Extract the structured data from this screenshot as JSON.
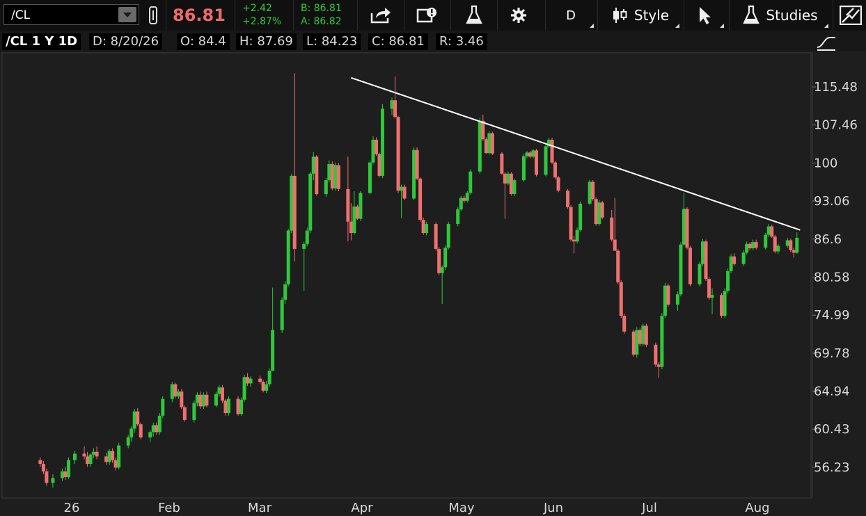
{
  "toolbar": {
    "symbol": "/CL",
    "last_price": "86.81",
    "change": "+2.42",
    "change_pct": "+2.87%",
    "bid": "B: 86.81",
    "ask": "A: 86.82",
    "aggregation": "D",
    "style_label": "Style",
    "studies_label": "Studies",
    "icons": [
      "link-icon",
      "share-icon",
      "screenshot-icon",
      "flask-icon",
      "gear-icon",
      "style-icon",
      "cursor-icon",
      "studies-flask-icon",
      "drawing-icon"
    ]
  },
  "info": {
    "symbol_period": "/CL 1 Y 1D",
    "date": "D: 8/20/26",
    "open": "O: 84.4",
    "high": "H: 87.69",
    "low": "L: 84.23",
    "close": "C: 86.81",
    "range": "R: 3.46"
  },
  "colors": {
    "up": "#2ec93a",
    "down": "#f07070",
    "background": "#1e1e1e",
    "trendline": "#ffffff"
  },
  "chart_data": {
    "type": "candlestick",
    "symbol": "/CL",
    "y_ticks": [
      "115.48",
      "107.46",
      "100",
      "93.06",
      "86.6",
      "80.58",
      "74.99",
      "69.78",
      "64.94",
      "60.43",
      "56.23"
    ],
    "y_scale": "log",
    "x_ticks": [
      "26",
      "Feb",
      "Mar",
      "Apr",
      "May",
      "Jun",
      "Jul",
      "Aug"
    ],
    "trendline": [
      {
        "date": "2026-03-31",
        "price": 117.5
      },
      {
        "date": "2026-08-21",
        "price": 88.1
      }
    ],
    "candles": [
      [
        "2025-12-22",
        57.0,
        57.3,
        56.3,
        56.6
      ],
      [
        "2025-12-23",
        56.6,
        56.9,
        55.5,
        55.8
      ],
      [
        "2025-12-24",
        55.8,
        56.1,
        54.3,
        54.6
      ],
      [
        "2025-12-26",
        54.6,
        55.5,
        54.1,
        55.1
      ],
      [
        "2025-12-29",
        55.1,
        56.1,
        54.8,
        55.8
      ],
      [
        "2025-12-30",
        55.8,
        56.3,
        54.9,
        55.2
      ],
      [
        "2025-12-31",
        55.2,
        57.3,
        55.0,
        57.0
      ],
      [
        "2026-01-02",
        57.0,
        58.0,
        56.6,
        57.7
      ],
      [
        "2026-01-05",
        57.7,
        58.5,
        57.1,
        57.4
      ],
      [
        "2026-01-06",
        57.4,
        57.9,
        56.3,
        56.6
      ],
      [
        "2026-01-07",
        56.6,
        57.8,
        56.3,
        57.6
      ],
      [
        "2026-01-08",
        57.6,
        58.3,
        57.2,
        57.9
      ],
      [
        "2026-01-09",
        57.9,
        58.5,
        57.1,
        57.4
      ],
      [
        "2026-01-12",
        57.4,
        57.8,
        56.5,
        56.8
      ],
      [
        "2026-01-13",
        56.8,
        58.2,
        56.5,
        58.0
      ],
      [
        "2026-01-14",
        58.0,
        58.3,
        56.7,
        57.0
      ],
      [
        "2026-01-15",
        57.0,
        57.3,
        55.9,
        56.2
      ],
      [
        "2026-01-16",
        56.2,
        58.9,
        56.0,
        58.6
      ],
      [
        "2026-01-19",
        58.6,
        59.8,
        58.3,
        59.5
      ],
      [
        "2026-01-20",
        59.5,
        60.8,
        59.0,
        60.5
      ],
      [
        "2026-01-21",
        60.5,
        62.8,
        60.0,
        62.5
      ],
      [
        "2026-01-22",
        62.5,
        62.9,
        60.8,
        61.0
      ],
      [
        "2026-01-23",
        61.0,
        61.2,
        59.3,
        59.5
      ],
      [
        "2026-01-26",
        59.5,
        60.3,
        59.0,
        60.1
      ],
      [
        "2026-01-27",
        60.1,
        61.2,
        59.6,
        60.9
      ],
      [
        "2026-01-28",
        60.9,
        61.2,
        59.8,
        60.1
      ],
      [
        "2026-01-29",
        60.1,
        62.3,
        59.8,
        62.0
      ],
      [
        "2026-01-30",
        62.0,
        64.3,
        61.7,
        64.0
      ],
      [
        "2026-02-02",
        64.0,
        66.1,
        63.6,
        65.8
      ],
      [
        "2026-02-03",
        65.8,
        66.0,
        64.1,
        64.3
      ],
      [
        "2026-02-04",
        64.3,
        65.2,
        64.0,
        64.9
      ],
      [
        "2026-02-05",
        64.9,
        65.2,
        62.8,
        63.0
      ],
      [
        "2026-02-06",
        63.0,
        63.2,
        61.3,
        61.5
      ],
      [
        "2026-02-09",
        61.5,
        63.8,
        61.2,
        63.5
      ],
      [
        "2026-02-10",
        63.5,
        64.8,
        63.1,
        64.5
      ],
      [
        "2026-02-11",
        64.5,
        64.9,
        62.8,
        63.1
      ],
      [
        "2026-02-12",
        63.1,
        64.8,
        62.8,
        64.5
      ],
      [
        "2026-02-13",
        64.5,
        64.9,
        63.0,
        63.2
      ],
      [
        "2026-02-16",
        63.2,
        64.9,
        63.0,
        64.6
      ],
      [
        "2026-02-17",
        64.6,
        65.7,
        64.3,
        65.4
      ],
      [
        "2026-02-18",
        65.4,
        65.7,
        63.5,
        63.8
      ],
      [
        "2026-02-19",
        63.8,
        64.0,
        62.0,
        62.3
      ],
      [
        "2026-02-20",
        62.3,
        64.3,
        62.0,
        64.0
      ],
      [
        "2026-02-23",
        64.0,
        64.3,
        62.0,
        62.2
      ],
      [
        "2026-02-24",
        62.2,
        64.2,
        62.0,
        63.9
      ],
      [
        "2026-02-25",
        63.9,
        67.0,
        63.6,
        66.7
      ],
      [
        "2026-02-26",
        66.7,
        67.2,
        65.6,
        65.9
      ],
      [
        "2026-02-27",
        65.9,
        66.8,
        65.5,
        66.5
      ],
      [
        "2026-03-02",
        66.5,
        66.9,
        65.8,
        66.1
      ],
      [
        "2026-03-03",
        66.1,
        66.3,
        64.8,
        65.0
      ],
      [
        "2026-03-04",
        65.0,
        66.2,
        64.7,
        65.8
      ],
      [
        "2026-03-05",
        65.8,
        67.8,
        65.5,
        67.5
      ],
      [
        "2026-03-06",
        67.5,
        79.0,
        70.5,
        72.9
      ],
      [
        "2026-03-09",
        72.9,
        77.6,
        72.5,
        77.2
      ],
      [
        "2026-03-10",
        77.2,
        80.0,
        76.6,
        79.5
      ],
      [
        "2026-03-11",
        79.5,
        88.3,
        79.2,
        88.0
      ],
      [
        "2026-03-12",
        88.0,
        98.0,
        87.6,
        97.6
      ],
      [
        "2026-03-13",
        97.6,
        118.5,
        83.0,
        85.0
      ],
      [
        "2026-03-16",
        85.0,
        86.2,
        78.5,
        85.8
      ],
      [
        "2026-03-17",
        85.8,
        88.5,
        85.4,
        88.0
      ],
      [
        "2026-03-18",
        88.0,
        98.4,
        87.6,
        98.0
      ],
      [
        "2026-03-19",
        98.0,
        102.1,
        96.8,
        101.2
      ],
      [
        "2026-03-20",
        101.2,
        101.5,
        94.0,
        94.3
      ],
      [
        "2026-03-23",
        94.3,
        97.2,
        93.8,
        96.8
      ],
      [
        "2026-03-24",
        96.8,
        100.5,
        96.4,
        99.8
      ],
      [
        "2026-03-25",
        99.8,
        100.3,
        95.0,
        95.3
      ],
      [
        "2026-03-26",
        95.3,
        100.1,
        94.9,
        99.6
      ],
      [
        "2026-03-27",
        99.6,
        100.0,
        94.8,
        95.2
      ],
      [
        "2026-03-30",
        95.2,
        101.2,
        86.2,
        89.5
      ],
      [
        "2026-03-31",
        89.5,
        92.7,
        86.4,
        87.6
      ],
      [
        "2026-04-01",
        87.6,
        94.8,
        87.3,
        92.1
      ],
      [
        "2026-04-02",
        92.1,
        92.4,
        89.8,
        90.0
      ],
      [
        "2026-04-03",
        90.0,
        94.8,
        89.6,
        94.5
      ],
      [
        "2026-04-06",
        94.5,
        100.5,
        94.2,
        100.1
      ],
      [
        "2026-04-07",
        100.1,
        105.2,
        99.7,
        104.5
      ],
      [
        "2026-04-08",
        104.5,
        105.0,
        101.4,
        101.7
      ],
      [
        "2026-04-09",
        101.7,
        102.0,
        97.3,
        97.6
      ],
      [
        "2026-04-10",
        97.6,
        111.8,
        97.2,
        110.8
      ],
      [
        "2026-04-13",
        110.8,
        113.2,
        109.5,
        112.6
      ],
      [
        "2026-04-14",
        112.6,
        117.8,
        108.8,
        109.1
      ],
      [
        "2026-04-15",
        109.1,
        109.3,
        94.5,
        94.9
      ],
      [
        "2026-04-16",
        94.9,
        96.0,
        90.1,
        95.6
      ],
      [
        "2026-04-17",
        95.6,
        96.0,
        93.2,
        93.5
      ],
      [
        "2026-04-20",
        93.5,
        103.0,
        93.2,
        102.5
      ],
      [
        "2026-04-21",
        102.5,
        103.0,
        96.8,
        97.1
      ],
      [
        "2026-04-22",
        97.1,
        97.3,
        89.5,
        89.8
      ],
      [
        "2026-04-23",
        89.8,
        90.2,
        87.3,
        87.6
      ],
      [
        "2026-04-24",
        87.6,
        89.5,
        87.2,
        89.1
      ],
      [
        "2026-04-27",
        89.1,
        89.4,
        84.7,
        85.0
      ],
      [
        "2026-04-28",
        85.0,
        85.3,
        80.9,
        81.2
      ],
      [
        "2026-04-29",
        81.2,
        82.4,
        76.6,
        82.1
      ],
      [
        "2026-04-30",
        82.1,
        85.6,
        81.7,
        85.2
      ],
      [
        "2026-05-01",
        85.2,
        89.5,
        84.9,
        89.1
      ],
      [
        "2026-05-04",
        89.1,
        92.0,
        88.7,
        91.6
      ],
      [
        "2026-05-05",
        91.6,
        94.0,
        91.3,
        93.6
      ],
      [
        "2026-05-06",
        93.6,
        94.0,
        92.7,
        93.1
      ],
      [
        "2026-05-07",
        93.1,
        94.8,
        92.8,
        94.5
      ],
      [
        "2026-05-08",
        94.5,
        98.8,
        94.2,
        98.4
      ],
      [
        "2026-05-11",
        98.4,
        108.9,
        98.0,
        108.3
      ],
      [
        "2026-05-12",
        108.3,
        109.6,
        104.3,
        104.6
      ],
      [
        "2026-05-13",
        104.6,
        105.0,
        101.7,
        101.9
      ],
      [
        "2026-05-14",
        101.9,
        106.2,
        101.6,
        105.8
      ],
      [
        "2026-05-15",
        105.8,
        106.1,
        101.5,
        101.8
      ],
      [
        "2026-05-18",
        101.8,
        102.1,
        97.8,
        98.0
      ],
      [
        "2026-05-19",
        98.0,
        98.3,
        90.0,
        96.2
      ],
      [
        "2026-05-20",
        96.2,
        98.4,
        95.9,
        98.0
      ],
      [
        "2026-05-21",
        98.0,
        98.3,
        94.0,
        94.3
      ],
      [
        "2026-05-22",
        94.3,
        97.1,
        93.9,
        96.8
      ],
      [
        "2026-05-25",
        96.8,
        101.7,
        96.5,
        101.3
      ],
      [
        "2026-05-26",
        101.3,
        102.3,
        101.0,
        102.0
      ],
      [
        "2026-05-27",
        102.0,
        102.3,
        100.9,
        101.2
      ],
      [
        "2026-05-28",
        101.2,
        102.7,
        100.9,
        102.4
      ],
      [
        "2026-05-29",
        102.4,
        102.7,
        97.5,
        97.8
      ],
      [
        "2026-06-01",
        97.8,
        103.6,
        97.5,
        103.2
      ],
      [
        "2026-06-02",
        103.2,
        104.9,
        102.9,
        104.5
      ],
      [
        "2026-06-03",
        104.5,
        104.9,
        99.8,
        100.1
      ],
      [
        "2026-06-04",
        100.1,
        100.4,
        97.0,
        97.3
      ],
      [
        "2026-06-05",
        97.3,
        97.6,
        94.6,
        94.9
      ],
      [
        "2026-06-08",
        94.9,
        95.2,
        91.7,
        92.0
      ],
      [
        "2026-06-09",
        92.0,
        92.3,
        86.2,
        86.5
      ],
      [
        "2026-06-10",
        86.5,
        87.1,
        84.3,
        86.2
      ],
      [
        "2026-06-11",
        86.2,
        88.5,
        85.9,
        88.1
      ],
      [
        "2026-06-12",
        88.1,
        93.0,
        87.8,
        92.6
      ],
      [
        "2026-06-15",
        92.6,
        96.9,
        92.3,
        96.5
      ],
      [
        "2026-06-16",
        96.5,
        96.8,
        93.1,
        93.4
      ],
      [
        "2026-06-17",
        93.4,
        93.7,
        88.8,
        89.1
      ],
      [
        "2026-06-18",
        89.1,
        93.2,
        88.8,
        92.8
      ],
      [
        "2026-06-19",
        92.8,
        93.1,
        89.9,
        90.2
      ],
      [
        "2026-06-22",
        90.2,
        91.5,
        86.2,
        86.5
      ],
      [
        "2026-06-23",
        86.5,
        93.6,
        86.2,
        84.7
      ],
      [
        "2026-06-24",
        84.7,
        85.0,
        79.5,
        79.8
      ],
      [
        "2026-06-25",
        79.8,
        80.1,
        74.6,
        74.9
      ],
      [
        "2026-06-26",
        74.9,
        75.2,
        72.4,
        72.7
      ],
      [
        "2026-06-29",
        72.7,
        73.0,
        69.3,
        69.6
      ],
      [
        "2026-06-30",
        69.6,
        73.3,
        69.2,
        72.9
      ],
      [
        "2026-07-01",
        72.9,
        73.2,
        70.7,
        71.0
      ],
      [
        "2026-07-02",
        71.0,
        73.8,
        70.7,
        73.5
      ],
      [
        "2026-07-03",
        73.5,
        73.8,
        70.6,
        70.9
      ],
      [
        "2026-07-06",
        70.9,
        71.2,
        68.0,
        68.3
      ],
      [
        "2026-07-07",
        68.3,
        68.6,
        66.6,
        68.0
      ],
      [
        "2026-07-08",
        68.0,
        75.3,
        67.7,
        74.9
      ],
      [
        "2026-07-09",
        74.9,
        79.7,
        74.6,
        79.3
      ],
      [
        "2026-07-10",
        79.3,
        79.6,
        76.2,
        76.5
      ],
      [
        "2026-07-13",
        76.5,
        78.4,
        75.6,
        78.0
      ],
      [
        "2026-07-14",
        78.0,
        86.1,
        77.7,
        85.7
      ],
      [
        "2026-07-15",
        85.7,
        94.5,
        85.4,
        91.7
      ],
      [
        "2026-07-16",
        91.7,
        92.0,
        84.9,
        85.2
      ],
      [
        "2026-07-17",
        85.2,
        85.5,
        79.2,
        79.5
      ],
      [
        "2026-07-20",
        79.5,
        83.0,
        79.2,
        82.6
      ],
      [
        "2026-07-21",
        82.6,
        86.6,
        82.3,
        86.2
      ],
      [
        "2026-07-22",
        86.2,
        86.5,
        80.0,
        80.3
      ],
      [
        "2026-07-23",
        80.3,
        80.6,
        77.2,
        77.5
      ],
      [
        "2026-07-24",
        77.5,
        78.9,
        75.1,
        77.9
      ],
      [
        "2026-07-27",
        77.9,
        78.2,
        74.6,
        74.9
      ],
      [
        "2026-07-28",
        74.9,
        78.9,
        74.6,
        78.5
      ],
      [
        "2026-07-29",
        78.5,
        81.9,
        78.2,
        81.5
      ],
      [
        "2026-07-30",
        81.5,
        84.2,
        81.2,
        83.8
      ],
      [
        "2026-07-31",
        83.8,
        84.3,
        82.3,
        82.6
      ],
      [
        "2026-08-03",
        82.6,
        84.8,
        82.3,
        84.4
      ],
      [
        "2026-08-04",
        84.4,
        86.2,
        84.1,
        85.8
      ],
      [
        "2026-08-05",
        85.8,
        86.1,
        84.8,
        85.1
      ],
      [
        "2026-08-06",
        85.1,
        86.5,
        84.8,
        86.1
      ],
      [
        "2026-08-07",
        86.1,
        86.5,
        84.9,
        85.2
      ],
      [
        "2026-08-10",
        85.2,
        87.6,
        84.9,
        87.3
      ],
      [
        "2026-08-11",
        87.3,
        89.1,
        86.9,
        88.7
      ],
      [
        "2026-08-12",
        88.7,
        89.0,
        86.8,
        87.0
      ],
      [
        "2026-08-13",
        87.0,
        87.3,
        84.3,
        84.6
      ],
      [
        "2026-08-14",
        84.6,
        85.8,
        84.2,
        85.5
      ],
      [
        "2026-08-17",
        85.5,
        86.8,
        85.2,
        86.4
      ],
      [
        "2026-08-18",
        86.4,
        86.7,
        84.5,
        84.8
      ],
      [
        "2026-08-19",
        84.8,
        85.2,
        83.6,
        84.4
      ],
      [
        "2026-08-20",
        84.4,
        87.69,
        84.23,
        86.81
      ]
    ]
  }
}
